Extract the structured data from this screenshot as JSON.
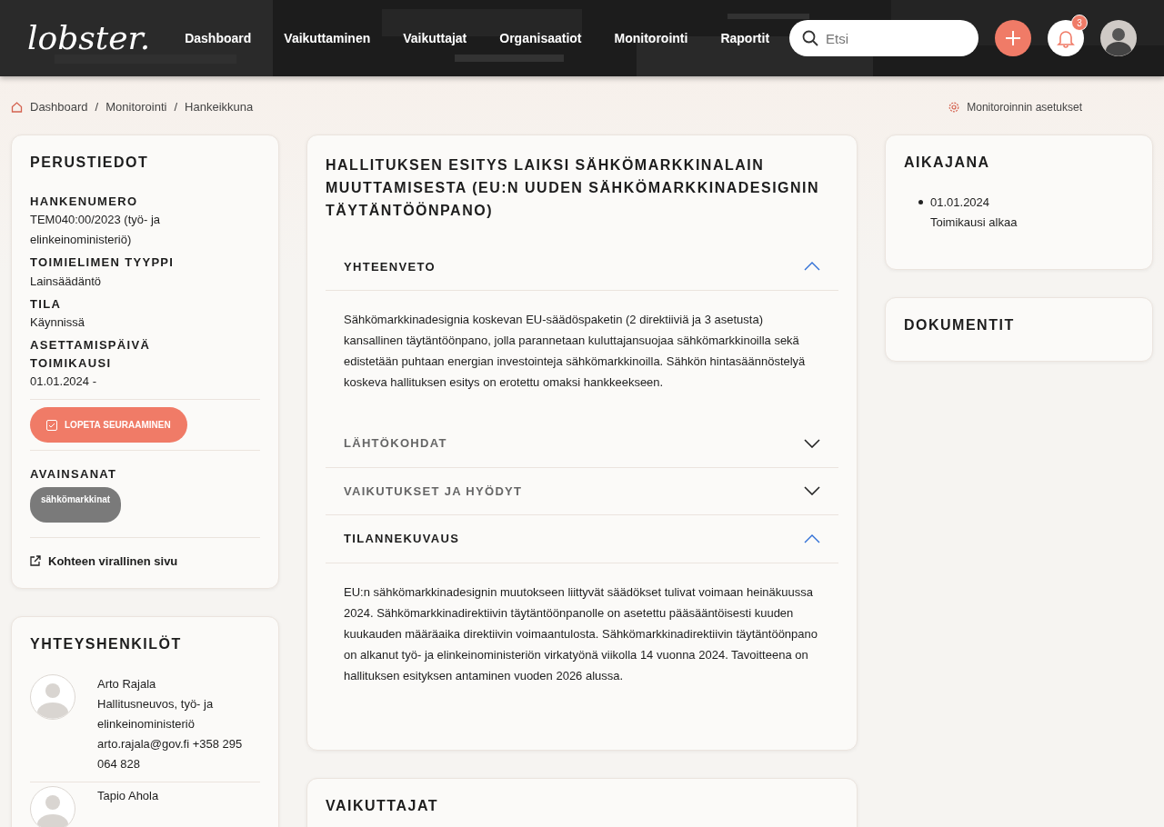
{
  "navbar": {
    "logo": "lobster.",
    "links": [
      {
        "label": "Dashboard"
      },
      {
        "label": "Vaikuttaminen"
      },
      {
        "label": "Vaikuttajat"
      },
      {
        "label": "Organisaatiot"
      },
      {
        "label": "Monitorointi"
      },
      {
        "label": "Raportit"
      }
    ],
    "search": {
      "placeholder": "Etsi"
    },
    "notifications": {
      "count": "3"
    }
  },
  "breadcrumb": {
    "separator": "/",
    "items": [
      "Dashboard",
      "Monitorointi",
      "Hankeikkuna"
    ]
  },
  "settings_link": "Monitoroinnin asetukset",
  "basic_info": {
    "title": "PERUSTIEDOT",
    "fields": [
      {
        "label": "HANKENUMERO",
        "value": "TEM040:00/2023 (työ- ja elinkeinoministeriö)"
      },
      {
        "label": "TOIMIELIMEN TYYPPI",
        "value": "Lainsäädäntö"
      },
      {
        "label": "TILA",
        "value": "Käynnissä"
      },
      {
        "label": "ASETTAMISPÄIVÄ"
      },
      {
        "label": "TOIMIKAUSI",
        "value": "01.01.2024 -"
      }
    ],
    "follow_button": "LOPETA SEURAAMINEN",
    "keywords_title": "AVAINSANAT",
    "keywords": [
      "sähkömarkkinat"
    ],
    "official_link": "Kohteen virallinen sivu"
  },
  "contacts": {
    "title": "YHTEYSHENKILÖT",
    "people": [
      {
        "name": "Arto Rajala",
        "role": "Hallitusneuvos, työ- ja elinkeinoministeriö",
        "contact": "arto.rajala@gov.fi +358 295 064 828"
      },
      {
        "name": "Tapio Ahola"
      }
    ]
  },
  "project": {
    "title": "HALLITUKSEN ESITYS LAIKSI SÄHKÖMARKKINALAIN MUUTTAMISESTA (EU:N UUDEN SÄHKÖMARKKINADESIGNIN TÄYTÄNTÖÖNPANO)",
    "sections": [
      {
        "title": "YHTEENVETO",
        "expanded": true,
        "text": "Sähkömarkkinadesignia koskevan EU-säädöspaketin (2 direktiiviä ja 3 asetusta) kansallinen täytäntöönpano, jolla parannetaan kuluttajansuojaa sähkömarkkinoilla sekä edistetään puhtaan energian investointeja sähkömarkkinoilla. Sähkön hintasäännöstelyä koskeva hallituksen esitys on erotettu omaksi hankkeekseen."
      },
      {
        "title": "LÄHTÖKOHDAT",
        "expanded": false
      },
      {
        "title": "VAIKUTUKSET JA HYÖDYT",
        "expanded": false
      },
      {
        "title": "TILANNEKUVAUS",
        "expanded": true,
        "text": "EU:n sähkömarkkinadesignin muutokseen liittyvät säädökset tulivat voimaan heinäkuussa 2024. Sähkömarkkinadirektiivin täytäntöönpanolle on asetettu pääsääntöisesti kuuden kuukauden määräaika direktiivin voimaantulosta. Sähkömarkkinadirektiivin täytäntöönpano on alkanut työ- ja elinkeinoministeriön virkatyönä viikolla 14 vuonna 2024. Tavoitteena on hallituksen esityksen antaminen vuoden 2026 alussa."
      }
    ]
  },
  "influencers": {
    "title": "VAIKUTTAJAT"
  },
  "timeline": {
    "title": "AIKAJANA",
    "events": [
      {
        "date": "01.01.2024",
        "label": "Toimikausi alkaa"
      }
    ]
  },
  "documents": {
    "title": "DOKUMENTIT"
  }
}
